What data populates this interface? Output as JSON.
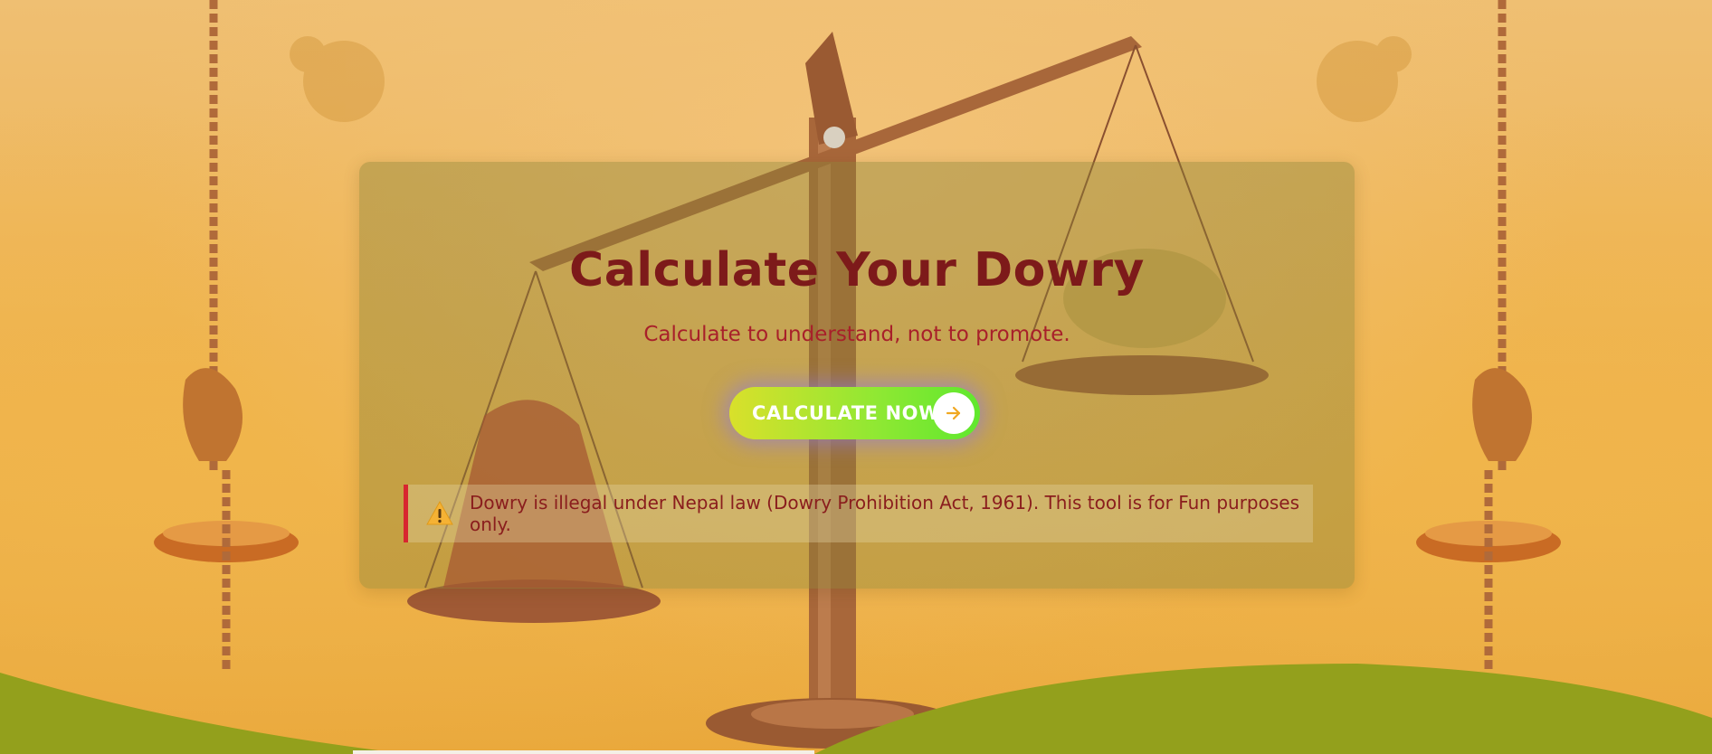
{
  "hero": {
    "title": "Calculate Your Dowry",
    "subtitle": "Calculate to understand, not to promote."
  },
  "cta": {
    "label": "CALCULATE NOW",
    "icon": "arrow-right-icon"
  },
  "notice": {
    "icon": "warning-icon",
    "text": "Dowry is illegal under Nepal law (Dowry Prohibition Act, 1961). This tool is for Fun purposes only."
  },
  "colors": {
    "title": "#7d1a1a",
    "subtitle": "#a8202a",
    "accent_green": "#8ee833",
    "notice_border": "#d8262f",
    "hill_green": "#93a01c"
  }
}
